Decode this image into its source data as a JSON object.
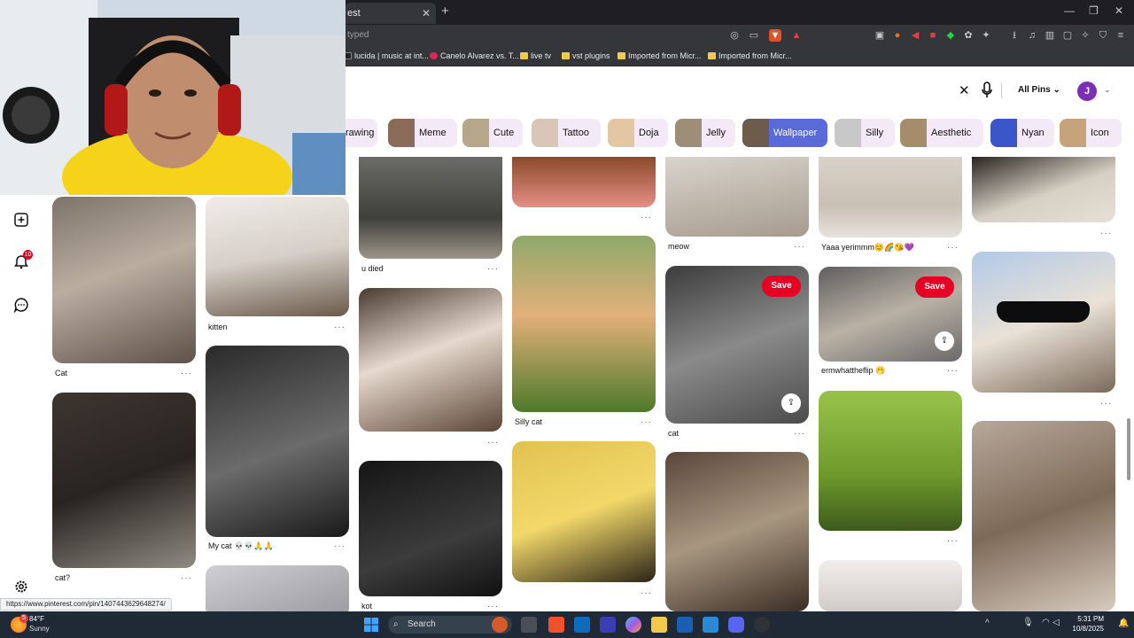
{
  "browser": {
    "tab_title": "est",
    "address_text": "typed",
    "bookmarks": [
      {
        "label": "lucida | music at int...",
        "color": "#1a1a1a"
      },
      {
        "label": "Canelo Alvarez vs. T...",
        "color": "#e0245e"
      },
      {
        "label": "live tv",
        "color": "#f2c94c"
      },
      {
        "label": "vst plugins",
        "color": "#f2c94c"
      },
      {
        "label": "Imported from Micr...",
        "color": "#f2c94c"
      },
      {
        "label": "Imported from Micr...",
        "color": "#f2c94c"
      }
    ]
  },
  "search": {
    "value": "",
    "scope_label": "All Pins",
    "avatar_initial": "J"
  },
  "chips": [
    {
      "label": "rawing",
      "color": "#d6c7a1"
    },
    {
      "label": "Meme",
      "color": "#8b6a5a"
    },
    {
      "label": "Cute",
      "color": "#b7a78a"
    },
    {
      "label": "Tattoo",
      "color": "#d8c6b6"
    },
    {
      "label": "Doja",
      "color": "#e3c7a2"
    },
    {
      "label": "Jelly",
      "color": "#9d8e78"
    },
    {
      "label": "Wallpaper",
      "color": "#6d5c4c"
    },
    {
      "label": "Silly",
      "color": "#c8c8c8"
    },
    {
      "label": "Aesthetic",
      "color": "#a58c6a"
    },
    {
      "label": "Nyan",
      "color": "#3a56c9"
    },
    {
      "label": "Icon",
      "color": "#c6a37a"
    }
  ],
  "sidebar": {
    "notification_count": "10"
  },
  "pins": {
    "col1": [
      {
        "caption": "Cat",
        "bg": "linear-gradient(160deg,#7d7368,#b9aea0 45%,#5e5249)"
      },
      {
        "caption": "cat?",
        "bg": "linear-gradient(160deg,#3c3530,#2a2421 50%,#8f8a82)"
      }
    ],
    "col2": [
      {
        "caption": "kitten",
        "bg": "linear-gradient(170deg,#f1ece8,#d6cfc8 50%,#6a5a4a)"
      },
      {
        "caption": "My cat 💀💀🙏🙏",
        "bg": "linear-gradient(160deg,#2a2a2a,#6b6b6b 55%,#1a1a1a)"
      },
      {
        "caption": "",
        "bg": "linear-gradient(160deg,#cfcfd2,#9a9a9e)"
      }
    ],
    "col3": [
      {
        "caption": "u died",
        "bg": "linear-gradient(180deg,#6b6b68,#3f3f3c 60%,#9c9588)"
      },
      {
        "caption": "",
        "bg": "linear-gradient(160deg,#4a3b30,#e6d8cc 45%,#5a4638)"
      },
      {
        "caption": "kot",
        "bg": "linear-gradient(160deg,#151515,#3c3c3c 60%,#111)"
      }
    ],
    "col4": [
      {
        "caption": "",
        "bg": "linear-gradient(180deg,#8a4a2a,#e58f86)"
      },
      {
        "caption": "Silly cat",
        "bg": "linear-gradient(180deg,#8fa86a,#e3b07a 45%,#4e7a2a)"
      },
      {
        "caption": "",
        "bg": "linear-gradient(160deg,#e1c24f,#f2d86a 50%,#2b2417)"
      }
    ],
    "col5": [
      {
        "caption": "meow",
        "bg": "linear-gradient(170deg,#d8d4cc,#a79b8e)"
      },
      {
        "caption": "cat",
        "bg": "linear-gradient(160deg,#3c3c3c,#8a8a8a 50%,#4b4b4b)",
        "save": "Save"
      },
      {
        "caption": "",
        "bg": "linear-gradient(160deg,#5a463c,#a8977f 50%,#3c2d25)"
      }
    ],
    "col6": [
      {
        "caption": "Yaaa yerimmm😊🌈😘💜",
        "bg": "linear-gradient(180deg,#d8d2c9,#c9c0b4 60%,#e6e2dc)"
      },
      {
        "caption": "ermwhattheflip 🫢",
        "bg": "linear-gradient(160deg,#5f5f5f,#b9b1a5 50%,#6a6a6a)",
        "save": "Save"
      },
      {
        "caption": "",
        "bg": "linear-gradient(180deg,#98c34a,#6e9a2c 60%,#3e5a1c)"
      },
      {
        "caption": "",
        "bg": "linear-gradient(180deg,#f0eeec,#d0cbc7)"
      }
    ],
    "col7": [
      {
        "caption": "",
        "bg": "linear-gradient(160deg,#2a2520,#d6cfc4 55%,#e6e0d6)"
      },
      {
        "caption": "",
        "bg": "linear-gradient(160deg,#b2c9e8,#e9e1d6 50%,#7b6a5a)"
      },
      {
        "caption": "",
        "bg": "linear-gradient(160deg,#b7a89a,#7e6a58 50%,#d7cbbf)"
      }
    ]
  },
  "status_url": "https://www.pinterest.com/pin/1407443629648274/",
  "taskbar": {
    "weather_temp": "84°F",
    "weather_cond": "Sunny",
    "search_label": "Search",
    "time": "5:31 PM",
    "date": "10/8/2025",
    "notification_badge": "5"
  }
}
